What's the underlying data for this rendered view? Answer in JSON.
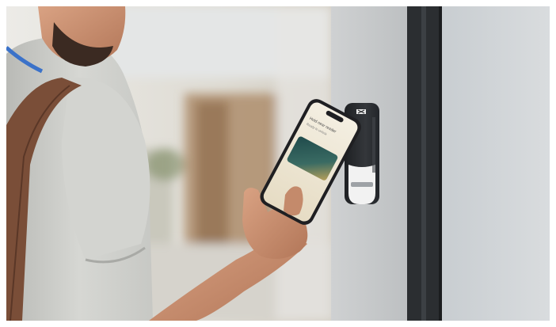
{
  "photo": {
    "subject": "person-tapping-phone-on-access-reader",
    "colors": {
      "background_wall": "#dcdcd8",
      "glass_panel": "#c9ced2",
      "door_frame": "#2b2e31",
      "door_panel": "#cfd2d3",
      "shirt": "#cfd0cc",
      "strap": "#7a4e38",
      "skin": "#c98f70",
      "beard": "#3b2a22",
      "phone_body": "#1f1f22",
      "phone_screen": "#efe9d8",
      "wallet_card": "#2d5b59",
      "reader_body": "#2a2c2f",
      "reader_base": "#f2f2f2"
    }
  },
  "screen": {
    "header_text": "Hold near reader",
    "sub_text": "Ready to unlock"
  }
}
